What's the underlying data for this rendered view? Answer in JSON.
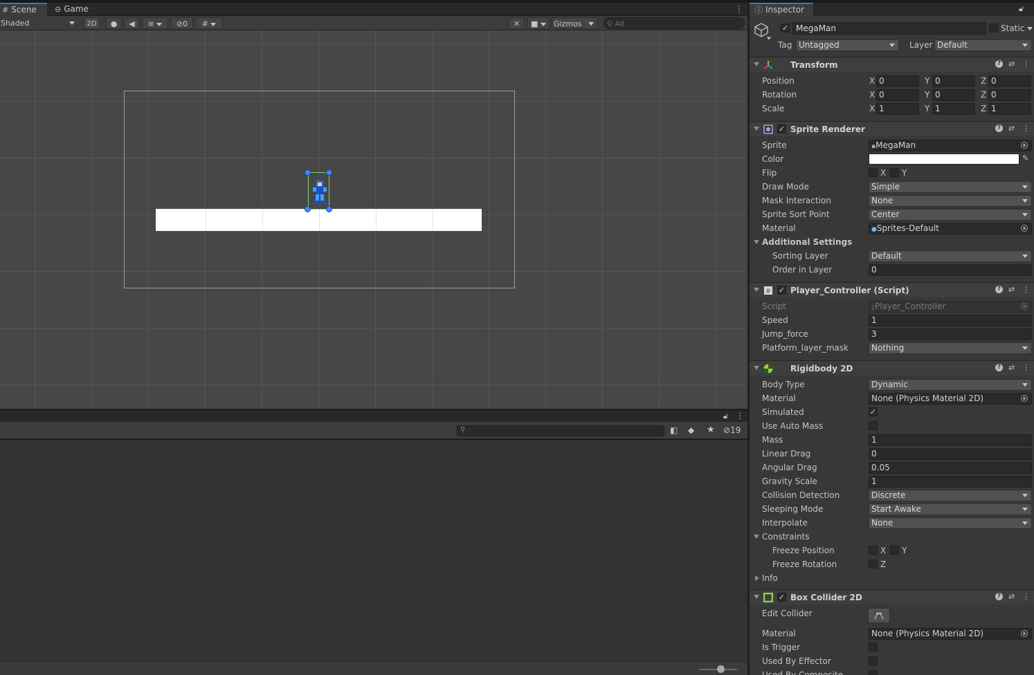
{
  "scene_tabs": [
    {
      "label": "Scene",
      "icon": "grid-icon"
    },
    {
      "label": "Game",
      "icon": "gamepad-icon"
    }
  ],
  "scene_toolbar": {
    "shading_mode": "Shaded",
    "mode_2d": "2D",
    "hidden_count": "0",
    "gizmos": "Gizmos",
    "search_placeholder": "All"
  },
  "project": {
    "hidden_count": "19"
  },
  "inspector": {
    "tab": "Inspector",
    "object_name": "MegaMan",
    "static_label": "Static",
    "tag_label": "Tag",
    "tag_value": "Untagged",
    "layer_label": "Layer",
    "layer_value": "Default",
    "transform": {
      "title": "Transform",
      "position_label": "Position",
      "rotation_label": "Rotation",
      "scale_label": "Scale",
      "axis_x": "X",
      "axis_y": "Y",
      "axis_z": "Z",
      "position": {
        "x": "0",
        "y": "0",
        "z": "0"
      },
      "rotation": {
        "x": "0",
        "y": "0",
        "z": "0"
      },
      "scale": {
        "x": "1",
        "y": "1",
        "z": "1"
      }
    },
    "sprite_renderer": {
      "title": "Sprite Renderer",
      "sprite_label": "Sprite",
      "sprite_value": "MegaMan",
      "color_label": "Color",
      "color_value": "#FFFFFF",
      "flip_label": "Flip",
      "flip_x": "X",
      "flip_y": "Y",
      "draw_mode_label": "Draw Mode",
      "draw_mode_value": "Simple",
      "mask_label": "Mask Interaction",
      "mask_value": "None",
      "sort_point_label": "Sprite Sort Point",
      "sort_point_value": "Center",
      "material_label": "Material",
      "material_value": "Sprites-Default",
      "additional_label": "Additional Settings",
      "sorting_layer_label": "Sorting Layer",
      "sorting_layer_value": "Default",
      "order_label": "Order in Layer",
      "order_value": "0"
    },
    "player_controller": {
      "title": "Player_Controller (Script)",
      "script_label": "Script",
      "script_value": "Player_Controller",
      "speed_label": "Speed",
      "speed_value": "1",
      "jump_label": "Jump_force",
      "jump_value": "3",
      "mask_label": "Platform_layer_mask",
      "mask_value": "Nothing"
    },
    "rigidbody": {
      "title": "Rigidbody 2D",
      "body_type_label": "Body Type",
      "body_type_value": "Dynamic",
      "material_label": "Material",
      "material_value": "None (Physics Material 2D)",
      "simulated_label": "Simulated",
      "simulated": true,
      "auto_mass_label": "Use Auto Mass",
      "auto_mass": false,
      "mass_label": "Mass",
      "mass_value": "1",
      "linear_drag_label": "Linear Drag",
      "linear_drag_value": "0",
      "angular_drag_label": "Angular Drag",
      "angular_drag_value": "0.05",
      "gravity_label": "Gravity Scale",
      "gravity_value": "1",
      "collision_label": "Collision Detection",
      "collision_value": "Discrete",
      "sleeping_label": "Sleeping Mode",
      "sleeping_value": "Start Awake",
      "interpolate_label": "Interpolate",
      "interpolate_value": "None",
      "constraints_label": "Constraints",
      "freeze_pos_label": "Freeze Position",
      "freeze_pos_x": "X",
      "freeze_pos_y": "Y",
      "freeze_rot_label": "Freeze Rotation",
      "freeze_rot_z": "Z",
      "info_label": "Info"
    },
    "box_collider": {
      "title": "Box Collider 2D",
      "edit_label": "Edit Collider",
      "material_label": "Material",
      "material_value": "None (Physics Material 2D)",
      "trigger_label": "Is Trigger",
      "effector_label": "Used By Effector",
      "composite_label": "Used By Composite"
    }
  },
  "colors": {
    "accent": "#3a79bb",
    "selection_green": "#7fd17a",
    "handle_blue": "#3a8bff"
  }
}
